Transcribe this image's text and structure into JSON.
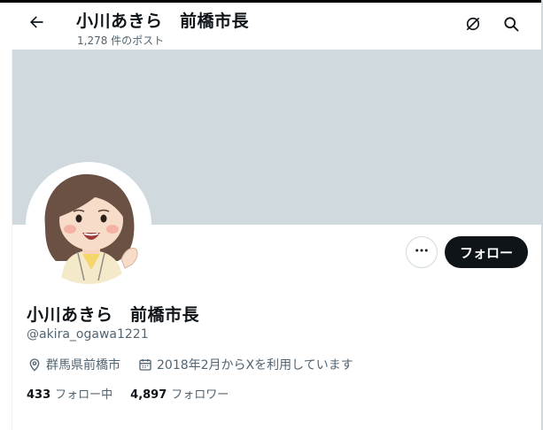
{
  "header": {
    "title": "小川あきら　前橋市長",
    "post_count": "1,278 件のポスト",
    "back_icon": "back-arrow-icon",
    "grok_icon": "grok-icon",
    "search_icon": "search-icon"
  },
  "profile": {
    "display_name": "小川あきら　前橋市長",
    "handle": "@akira_ogawa1221",
    "location": "群馬県前橋市",
    "joined": "2018年2月からXを利用しています",
    "following_count": "433",
    "following_label": "フォロー中",
    "followers_count": "4,897",
    "followers_label": "フォロワー"
  },
  "actions": {
    "follow_label": "フォロー",
    "more_icon": "more-icon"
  },
  "colors": {
    "banner": "#cfd9de",
    "text_primary": "#0f1419",
    "text_secondary": "#536471",
    "follow_bg": "#0f1419"
  }
}
